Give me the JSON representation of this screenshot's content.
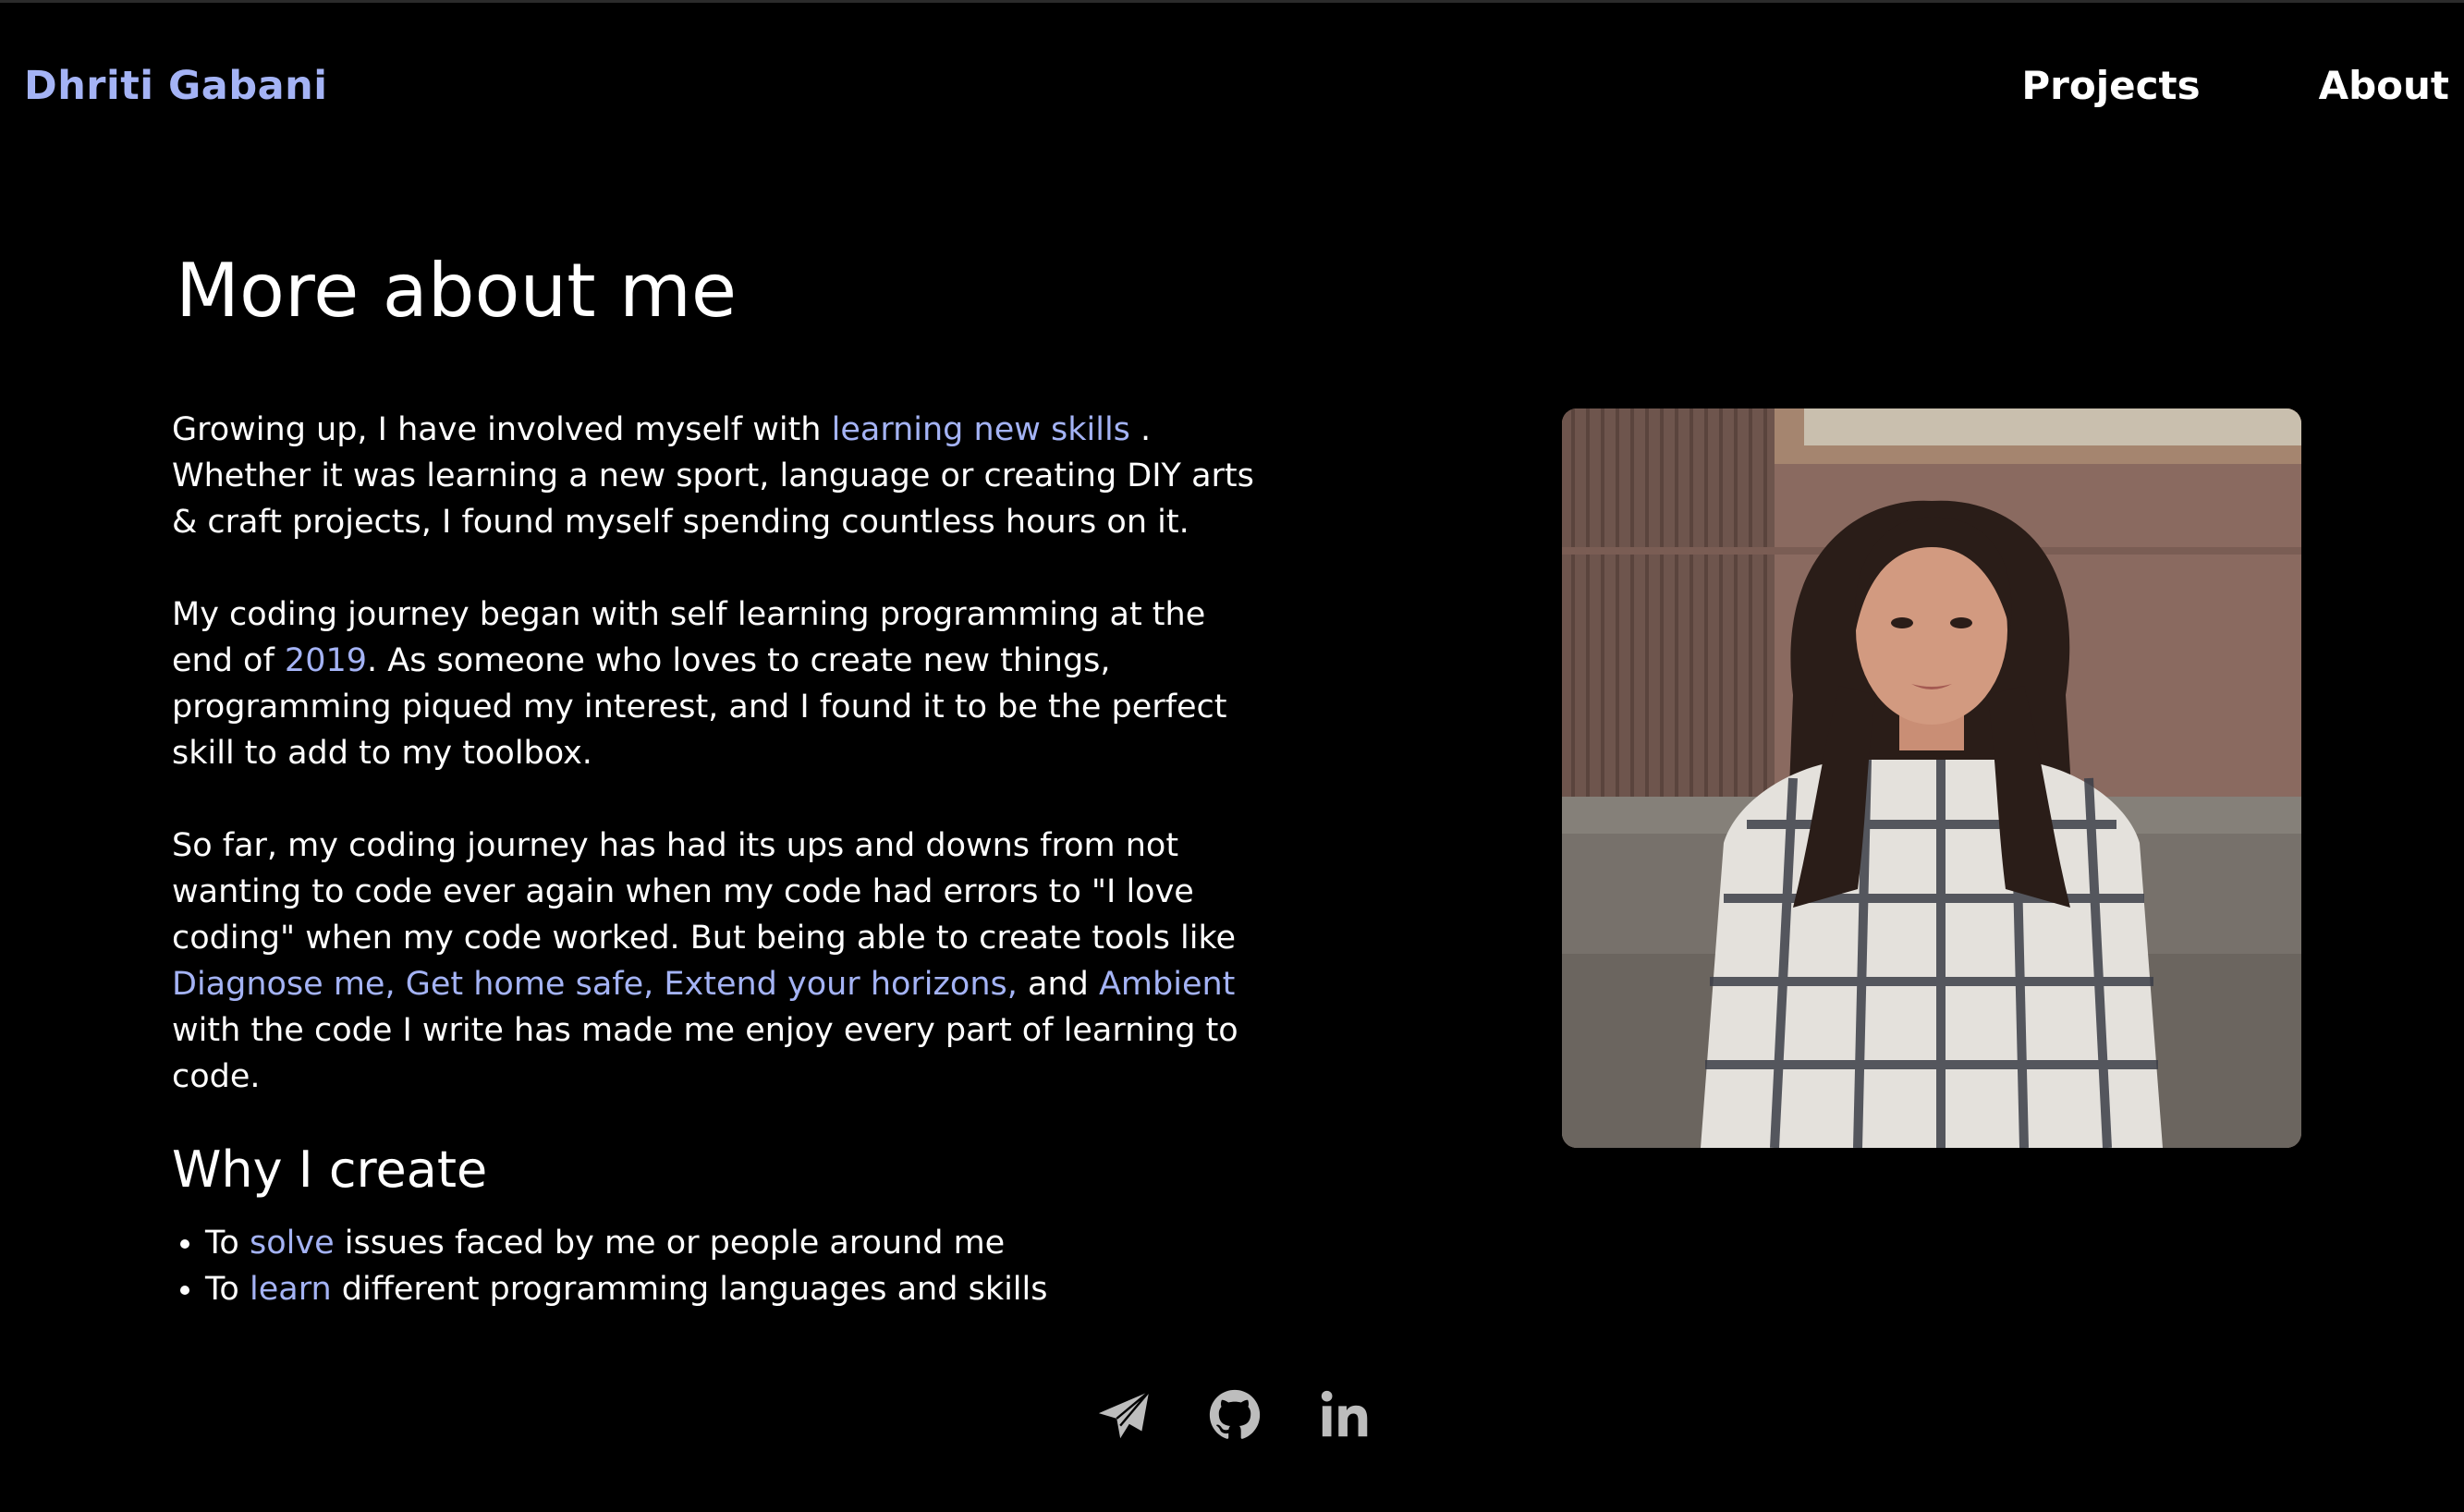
{
  "header": {
    "brand": "Dhriti Gabani",
    "nav": [
      {
        "label": "Projects"
      },
      {
        "label": "About"
      }
    ]
  },
  "main": {
    "title": "More about me",
    "para1": {
      "before": "Growing up, I have involved myself with ",
      "link": "learning new skills",
      "after": " . Whether it was learning a new sport, language or creating DIY arts & craft projects, I found myself spending countless hours on it."
    },
    "para2": {
      "before": "My coding journey began with self learning programming at the end of ",
      "highlight": "2019",
      "after": ". As someone who loves to create new things, programming piqued my interest, and I found it to be the perfect skill to add to my toolbox."
    },
    "para3": {
      "before": "So far, my coding journey has had its ups and downs from not wanting to code ever again when my code had errors to \"I love coding\" when my code worked. But being able to create tools like ",
      "projects": [
        "Diagnose me,",
        "Get home safe,",
        "Extend your horizons,"
      ],
      "and": " and ",
      "last_project": "Ambient",
      "after": " with the code I write has made me enjoy every part of learning to code."
    },
    "why": {
      "title": "Why I create",
      "items": [
        {
          "before": "To ",
          "highlight": "solve",
          "after": " issues faced by me or people around me"
        },
        {
          "before": "To ",
          "highlight": "learn",
          "after": " different programming languages and skills"
        }
      ]
    }
  },
  "footer": {
    "icons": [
      "send-icon",
      "github-icon",
      "linkedin-icon"
    ]
  },
  "colors": {
    "background": "#000000",
    "accent": "#a4b3f5",
    "text": "#ffffff",
    "icon": "#bdbdbd"
  }
}
